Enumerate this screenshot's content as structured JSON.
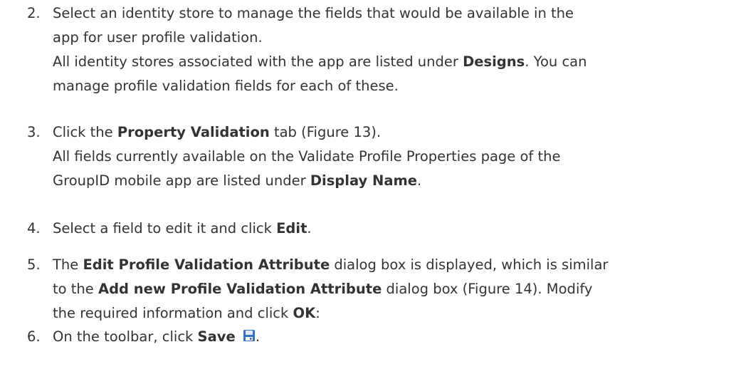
{
  "steps": [
    {
      "number": "2.",
      "lines": [
        [
          {
            "text": "Select an identity store to manage the fields that would be available in the",
            "bold": false
          }
        ],
        [
          {
            "text": "app for user profile validation.",
            "bold": false
          }
        ],
        [
          {
            "text": "All identity stores associated with the app are listed under ",
            "bold": false
          },
          {
            "text": "Designs",
            "bold": true
          },
          {
            "text": ". You can",
            "bold": false
          }
        ],
        [
          {
            "text": "manage profile validation fields for each of these.",
            "bold": false
          }
        ]
      ]
    },
    {
      "number": "3.",
      "lines": [
        [
          {
            "text": "Click the ",
            "bold": false
          },
          {
            "text": "Property Validation",
            "bold": true
          },
          {
            "text": " tab (Figure 13).",
            "bold": false
          }
        ],
        [
          {
            "text": "All fields currently available on the Validate Profile Properties page of the",
            "bold": false
          }
        ],
        [
          {
            "text": "GroupID mobile app are listed under ",
            "bold": false
          },
          {
            "text": "Display Name",
            "bold": true
          },
          {
            "text": ".",
            "bold": false
          }
        ]
      ]
    },
    {
      "number": "4.",
      "lines": [
        [
          {
            "text": "Select a field to edit it and click ",
            "bold": false
          },
          {
            "text": "Edit",
            "bold": true
          },
          {
            "text": ".",
            "bold": false
          }
        ]
      ]
    },
    {
      "number": "5.",
      "lines": [
        [
          {
            "text": "The ",
            "bold": false
          },
          {
            "text": "Edit Profile Validation Attribute",
            "bold": true
          },
          {
            "text": " dialog box is displayed, which is similar",
            "bold": false
          }
        ],
        [
          {
            "text": "to the ",
            "bold": false
          },
          {
            "text": "Add new Profile Validation Attribute",
            "bold": true
          },
          {
            "text": " dialog box (Figure 14). Modify",
            "bold": false
          }
        ],
        [
          {
            "text": "the required information and click ",
            "bold": false
          },
          {
            "text": "OK",
            "bold": true
          },
          {
            "text": ":",
            "bold": false
          }
        ]
      ]
    },
    {
      "number": "6.",
      "lines": [
        [
          {
            "text": " On the toolbar, click ",
            "bold": false
          },
          {
            "text": "Save",
            "bold": true
          },
          {
            "text": " ",
            "bold": false
          },
          {
            "icon": "save-icon"
          },
          {
            "text": ".",
            "bold": false
          }
        ]
      ]
    }
  ],
  "colors": {
    "text": "#333333",
    "background": "#ffffff",
    "save_icon_primary": "#3a6fc4",
    "save_icon_label": "#dfe9f7"
  }
}
